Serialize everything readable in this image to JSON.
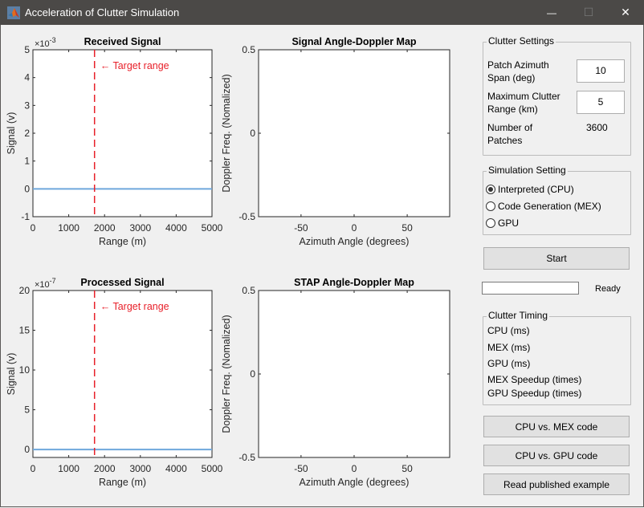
{
  "window": {
    "title": "Acceleration of Clutter Simulation",
    "controls": {
      "minimize": "—",
      "maximize": "☐",
      "close": "✕"
    }
  },
  "chart_data": [
    {
      "id": "received",
      "type": "line",
      "title": "Received Signal",
      "xlabel": "Range (m)",
      "ylabel": "Signal (v)",
      "xlim": [
        0,
        5000
      ],
      "ylim": [
        -1,
        5
      ],
      "y_exponent": "×10",
      "y_exponent_power": "-3",
      "xticks": [
        "0",
        "1000",
        "2000",
        "3000",
        "4000",
        "5000"
      ],
      "yticks": [
        "-1",
        "0",
        "1",
        "2",
        "3",
        "4",
        "5"
      ],
      "series": [
        {
          "name": "signal",
          "x": [
            0,
            5000
          ],
          "y": [
            0,
            0
          ],
          "color": "#6fa8dc"
        }
      ],
      "annotation": {
        "text": "← Target range",
        "target_range": 1720,
        "color": "#e8202a"
      }
    },
    {
      "id": "signal-map",
      "type": "heatmap",
      "title": "Signal Angle-Doppler Map",
      "xlabel": "Azimuth Angle (degrees)",
      "ylabel": "Doppler Freq. (Nomalized)",
      "xlim": [
        -90,
        90
      ],
      "ylim": [
        -0.5,
        0.5
      ],
      "xticks": [
        "-50",
        "0",
        "50"
      ],
      "yticks": [
        "-0.5",
        "0",
        "0.5"
      ]
    },
    {
      "id": "processed",
      "type": "line",
      "title": "Processed Signal",
      "xlabel": "Range (m)",
      "ylabel": "Signal (v)",
      "xlim": [
        0,
        5000
      ],
      "ylim": [
        -1,
        20
      ],
      "y_exponent": "×10",
      "y_exponent_power": "-7",
      "xticks": [
        "0",
        "1000",
        "2000",
        "3000",
        "4000",
        "5000"
      ],
      "yticks": [
        "0",
        "5",
        "10",
        "15",
        "20"
      ],
      "series": [
        {
          "name": "signal",
          "x": [
            0,
            5000
          ],
          "y": [
            0,
            0
          ],
          "color": "#6fa8dc"
        }
      ],
      "annotation": {
        "text": "← Target range",
        "target_range": 1720,
        "color": "#e8202a"
      }
    },
    {
      "id": "stap-map",
      "type": "heatmap",
      "title": "STAP Angle-Doppler Map",
      "xlabel": "Azimuth Angle (degrees)",
      "ylabel": "Doppler Freq. (Nomalized)",
      "xlim": [
        -90,
        90
      ],
      "ylim": [
        -0.5,
        0.5
      ],
      "xticks": [
        "-50",
        "0",
        "50"
      ],
      "yticks": [
        "-0.5",
        "0",
        "0.5"
      ]
    }
  ],
  "clutter_settings": {
    "title": "Clutter Settings",
    "patch_span_label_1": "Patch Azimuth",
    "patch_span_label_2": "Span (deg)",
    "patch_span_value": "10",
    "max_range_label_1": "Maximum Clutter",
    "max_range_label_2": "Range (km)",
    "max_range_value": "5",
    "num_patches_label_1": "Number of",
    "num_patches_label_2": "Patches",
    "num_patches_value": "3600"
  },
  "simulation_setting": {
    "title": "Simulation Setting",
    "options": [
      {
        "label": "Interpreted (CPU)",
        "selected": true
      },
      {
        "label": "Code Generation (MEX)",
        "selected": false
      },
      {
        "label": "GPU",
        "selected": false
      }
    ]
  },
  "start_button": "Start",
  "progress": {
    "value": 0,
    "status": "Ready"
  },
  "clutter_timing": {
    "title": "Clutter Timing",
    "rows": [
      "CPU (ms)",
      "MEX (ms)",
      "GPU (ms)",
      "MEX Speedup (times)",
      "GPU Speedup (times)"
    ]
  },
  "buttons": {
    "cpu_vs_mex": "CPU vs. MEX code",
    "cpu_vs_gpu": "CPU vs. GPU code",
    "read_example": "Read published example"
  }
}
